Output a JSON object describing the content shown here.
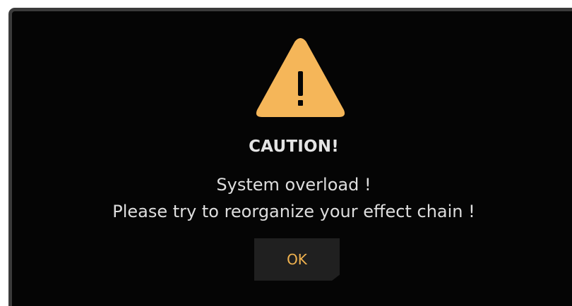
{
  "dialog": {
    "title": "CAUTION!",
    "message_lines": [
      "System overload !",
      "Please try to reorganize your effect chain !"
    ],
    "ok_label": "OK",
    "icon": "warning-icon",
    "colors": {
      "background": "#050505",
      "border": "#3b3b3b",
      "accent": "#f5b659",
      "text": "#e4e4e4",
      "button_bg": "#202020",
      "button_text": "#f0b24f"
    }
  }
}
